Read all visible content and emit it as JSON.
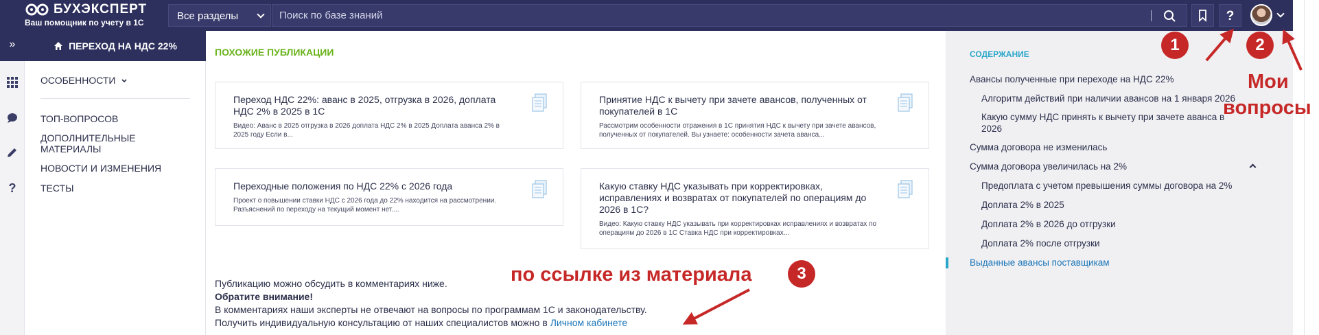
{
  "header": {
    "logo_title": "БУХЭКСПЕРТ",
    "logo_subtitle": "Ваш помощник по учету в 1С",
    "section_select": "Все разделы",
    "search_placeholder": "Поиск по базе знаний"
  },
  "leftbar": {
    "expand_glyph": "»",
    "icons": [
      "grid-icon",
      "chat-icon",
      "pencil-icon",
      "question-icon"
    ]
  },
  "menu": {
    "head": "ПЕРЕХОД НА НДС 22%",
    "items": [
      "ОСОБЕННОСТИ",
      "ТОП-ВОПРОСОВ",
      "ДОПОЛНИТЕЛЬНЫЕ МАТЕРИАЛЫ",
      "НОВОСТИ И ИЗМЕНЕНИЯ",
      "ТЕСТЫ"
    ]
  },
  "main": {
    "similar_title": "ПОХОЖИЕ ПУБЛИКАЦИИ",
    "cards": [
      {
        "title": "Переход НДС 22%: аванс в 2025, отгрузка в 2026, доплата НДС 2% в 2025 в 1С",
        "desc": "Видео: Аванс в 2025 отгрузка в 2026 доплата НДС 2% в 2025 Доплата аванса 2% в 2025 году Если в..."
      },
      {
        "title": "Принятие НДС к вычету при зачете авансов, полученных от покупателей в 1С",
        "desc": "Рассмотрим особенности отражения в 1С принятия НДС к вычету при зачете авансов, полученных от покупателей. Вы узнаете: особенности зачета аванса..."
      },
      {
        "title": "Переходные положения по НДС 22% с 2026 года",
        "desc": "Проект о повышении ставки НДС с 2026 года до 22% находится на рассмотрении. Разъяснений по переходу на текущий момент нет...."
      },
      {
        "title": "Какую ставку НДС указывать при корректировках, исправлениях и возвратах от покупателей по операциям до 2026 в 1С?",
        "desc": "Видео: Какую ставку НДС указывать при корректировках исправлениях и возвратах по операциям до 2026 в 1С Ставка НДС при корректировках..."
      }
    ],
    "footer_line1": "Публикацию можно обсудить в комментариях ниже.",
    "footer_line2": "Обратите внимание!",
    "footer_line3": "В комментариях наши эксперты не отвечают на вопросы по программам 1С и законодательству.",
    "footer_line4": "Получить индивидуальную консультацию от наших специалистов можно в",
    "footer_link": "Личном кабинете"
  },
  "toc": {
    "title": "СОДЕРЖАНИЕ",
    "items": [
      "Авансы полученные при переходе на НДС 22%",
      "Алгоритм действий при наличии авансов на 1 января 2026",
      "Какую сумму НДС принять к вычету при зачете аванса в 2026",
      "Сумма договора не изменилась",
      "Сумма договора увеличилась на 2%",
      "Предоплата с учетом превышения суммы договора на 2%",
      "Доплата 2% в 2025",
      "Доплата 2% в 2026 до отгрузки",
      "Доплата 2% после отгрузки",
      "Выданные авансы поставщикам"
    ]
  },
  "annotations": {
    "n1": "1",
    "n2": "2",
    "n3": "3",
    "my_questions_1": "Мои",
    "my_questions_2": "вопросы",
    "from_link": "по ссылке из материала",
    "color": "#c62828"
  },
  "colors": {
    "header_bg": "#2d2f5c",
    "accent_green": "#6ab31c",
    "accent_cyan": "#2aa6c9",
    "link_blue": "#1a75b8",
    "toc_bg": "#f0f0f3"
  }
}
